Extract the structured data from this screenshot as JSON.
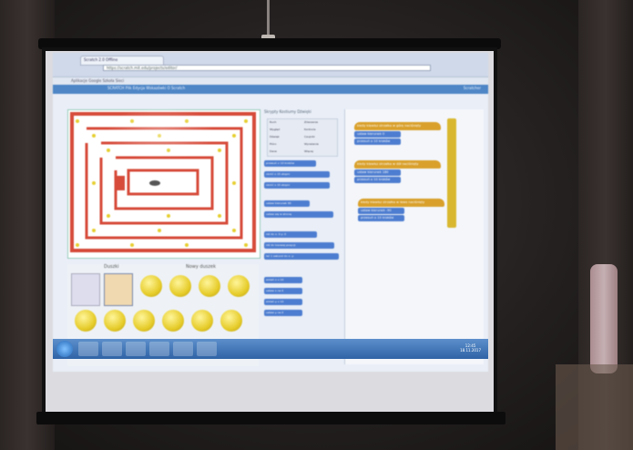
{
  "browser": {
    "tab_title": "Scratch 2.0 Offline",
    "url": "https://scratch.mit.edu/projects/editor/",
    "bookmarks": "Aplikacje  Google  Szkoła  Sieci"
  },
  "menu": {
    "items": "SCRATCH   Plik   Edycja   Wskazówki   O Scratch",
    "user": "Scratcher"
  },
  "sprites_pane": {
    "title": "Duszki",
    "new_sprite_label": "Nowy duszek"
  },
  "palette": {
    "tabs": "Skrypty   Kostiumy   Dźwięki",
    "categories": [
      "Ruch",
      "Wygląd",
      "Dźwięk",
      "Pióro",
      "Dane",
      "Zdarzenia",
      "Kontrola",
      "Czujniki",
      "Wyrażenia",
      "Więcej"
    ]
  },
  "blocks": [
    "przesuń o 10 kroków",
    "obróć o 15 stopni",
    "obróć o 15 stopni",
    "ustaw kierunek 90",
    "ustaw się w stronę",
    "idź do x: 0 y: 0",
    "idź do losowej pozycji",
    "leć 1 sekund do x: y:",
    "zmień x o 10",
    "ustaw x na 0",
    "zmień y o 10",
    "ustaw y na 0"
  ],
  "scripts": [
    {
      "hat": "kiedy klawisz strzałka w górę naciśnięty",
      "steps": [
        "ustaw kierunek 0",
        "przesuń o 10 kroków"
      ]
    },
    {
      "hat": "kiedy klawisz strzałka w dół naciśnięty",
      "steps": [
        "ustaw kierunek 180",
        "przesuń o 10 kroków"
      ]
    },
    {
      "hat": "kiedy klawisz strzałka w lewo naciśnięty",
      "steps": [
        "ustaw kierunek -90",
        "przesuń o 10 kroków"
      ]
    }
  ],
  "taskbar": {
    "time": "12:45",
    "date": "18.11.2017"
  }
}
